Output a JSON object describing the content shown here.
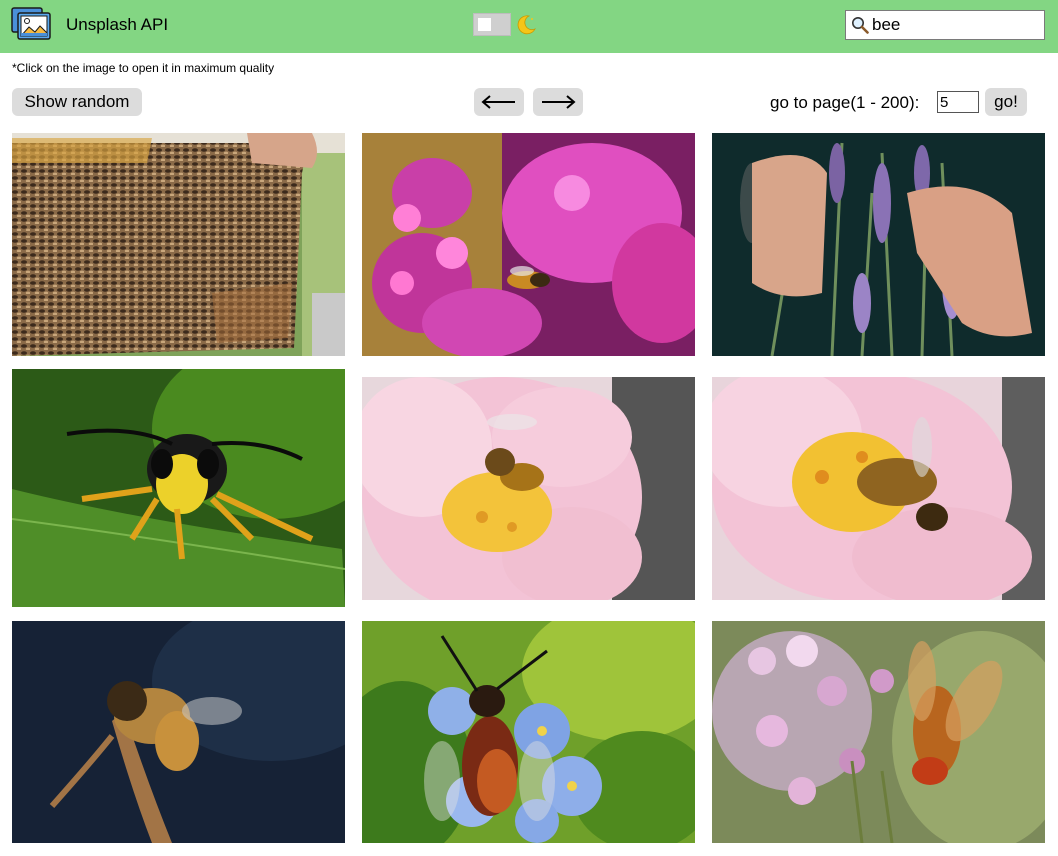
{
  "header": {
    "title": "Unsplash API",
    "logo_icon": "gallery-logo-icon",
    "theme_toggle_icon": "moon-icon",
    "background_color": "#83d683"
  },
  "search": {
    "value": "bee",
    "placeholder": ""
  },
  "hint": "*Click on the image to open it in maximum quality",
  "controls": {
    "random_label": "Show random",
    "prev_icon": "arrow-left-icon",
    "next_icon": "arrow-right-icon",
    "page_label": "go to page(1 - 200):",
    "page_value": "5",
    "go_label": "go!"
  },
  "photos": [
    {
      "subject": "bees on honeycomb frame"
    },
    {
      "subject": "bee on pink flowers"
    },
    {
      "subject": "hands holding lavender"
    },
    {
      "subject": "wasp on leaf"
    },
    {
      "subject": "bee on pink flower"
    },
    {
      "subject": "bee on pink flower close-up"
    },
    {
      "subject": "bee on dry twig"
    },
    {
      "subject": "bee on blue flowers"
    },
    {
      "subject": "hoverfly on lilac blossoms"
    }
  ]
}
